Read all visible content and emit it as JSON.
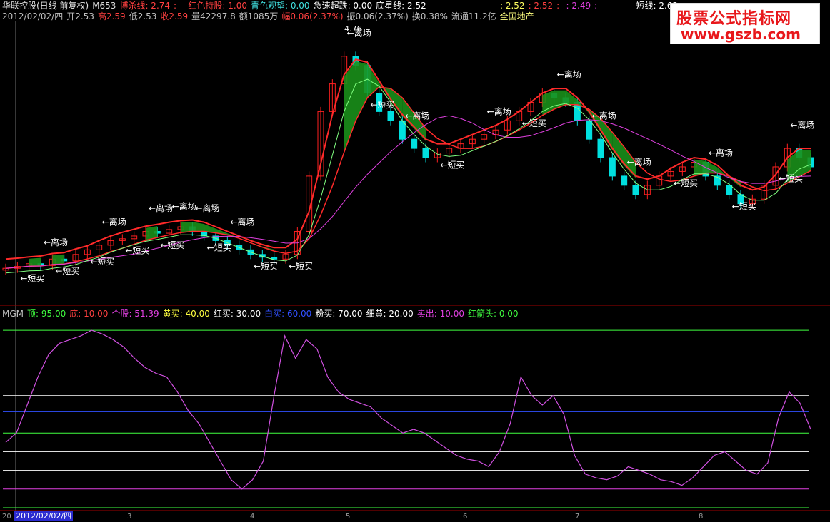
{
  "info_line_1": {
    "name": "华联控股(日线 前复权)",
    "code": "M653",
    "f1_label": "博杀线: 2.74",
    "f1_sep": ":-",
    "f2_label": "红色持股: 1.00",
    "f3_label": "青色观望: 0.00",
    "f4_label": "急速超跌: 0.00",
    "f5_label": "底星线: 2.52",
    "f6_label": ": 2.52",
    "f7_label": ": 2.52",
    "f7_sep": ":-",
    "f8_label": ": 2.49",
    "f8_sep": ":-",
    "f9_label": "短线: 2.63",
    "f9_sep": ":-"
  },
  "info_line_2": {
    "date": "2012/02/02/四",
    "open": "开2.53",
    "high": "高2.59",
    "low": "低2.53",
    "close": "收2.59",
    "volume": "量42297.8",
    "amount": "额1085万",
    "change": "幅0.06(2.37%)",
    "amplitude": "振0.06(2.37%)",
    "turnover": "换0.38%",
    "float": "流通11.2亿",
    "sector": "全国地产"
  },
  "watermark": {
    "title": "股票公式指标网",
    "url": "www.gszb.com"
  },
  "indicator_header": {
    "name": "MGM",
    "top": "顶: 95.00",
    "bottom": "底: 10.00",
    "stock": "个股: 51.39",
    "yellow_buy": "黄买: 40.00",
    "red_buy": "红买: 30.00",
    "white_buy": "白买: 60.00",
    "pink_buy": "粉买: 70.00",
    "thin_yellow": "细黄: 20.00",
    "sell": "卖出: 10.00",
    "red_arrow": "红箭头: 0.00"
  },
  "colors": {
    "background": "#000000",
    "up_candle": "#ff2020",
    "down_candle": "#00e0e0",
    "ma_red": "#ff2a2a",
    "ma_magenta": "#e040e0",
    "ma_green": "#80ff80",
    "band_green": "#1a8f1a",
    "short_buy": "#ffffff",
    "exit": "#ffffff",
    "oscillator": "#d050e0"
  },
  "chart_data": {
    "type": "candlestick",
    "date_readout": "2012/02/02/四",
    "x_ticks": [
      "20",
      "3",
      "4",
      "5",
      "6",
      "7",
      "8"
    ],
    "high_marker": "4.76",
    "annotations_exit": [
      "←离场",
      "←离场",
      "←离场",
      "←离场",
      "←离场",
      "←离场",
      "←离场",
      "←离场",
      "←离场",
      "←离场",
      "←离场",
      "←离场",
      "←离场",
      "←离场"
    ],
    "annotations_buy": [
      "←短买",
      "←短买",
      "←短买",
      "←短买",
      "←短买",
      "←短买",
      "←短买",
      "←短买",
      "←短买",
      "←短买",
      "←短买",
      "←短买",
      "←短买",
      "←短买"
    ],
    "closes": [
      2.3,
      2.32,
      2.35,
      2.33,
      2.4,
      2.38,
      2.45,
      2.5,
      2.55,
      2.6,
      2.62,
      2.65,
      2.7,
      2.68,
      2.72,
      2.75,
      2.7,
      2.65,
      2.6,
      2.55,
      2.5,
      2.45,
      2.42,
      2.4,
      2.45,
      2.7,
      3.3,
      4.0,
      4.3,
      4.6,
      4.5,
      4.2,
      4.0,
      3.9,
      3.7,
      3.6,
      3.5,
      3.55,
      3.6,
      3.65,
      3.7,
      3.75,
      3.8,
      3.9,
      4.0,
      4.1,
      4.2,
      4.15,
      4.1,
      3.9,
      3.7,
      3.5,
      3.3,
      3.2,
      3.1,
      3.2,
      3.3,
      3.35,
      3.4,
      3.45,
      3.3,
      3.2,
      3.1,
      3.0,
      3.05,
      3.2,
      3.4,
      3.6,
      3.5,
      3.4
    ],
    "indicator": {
      "levels": [
        {
          "name": "顶",
          "value": 95
        },
        {
          "name": "白买",
          "value": 60
        },
        {
          "name": "个股",
          "value": 51.39
        },
        {
          "name": "黄买",
          "value": 40
        },
        {
          "name": "红买",
          "value": 30
        },
        {
          "name": "细黄",
          "value": 20
        },
        {
          "name": "卖出",
          "value": 10
        },
        {
          "name": "红箭头",
          "value": 0
        }
      ],
      "oscillator": [
        35,
        40,
        55,
        70,
        82,
        88,
        90,
        92,
        95,
        93,
        90,
        86,
        80,
        75,
        72,
        70,
        62,
        52,
        45,
        35,
        25,
        15,
        10,
        15,
        25,
        60,
        92,
        80,
        90,
        85,
        70,
        62,
        58,
        56,
        54,
        48,
        44,
        40,
        42,
        40,
        36,
        32,
        28,
        26,
        25,
        22,
        30,
        45,
        70,
        60,
        55,
        60,
        50,
        28,
        18,
        16,
        15,
        17,
        22,
        20,
        18,
        15,
        14,
        12,
        16,
        22,
        28,
        30,
        25,
        20,
        18,
        24,
        48,
        62,
        56,
        42
      ]
    }
  }
}
